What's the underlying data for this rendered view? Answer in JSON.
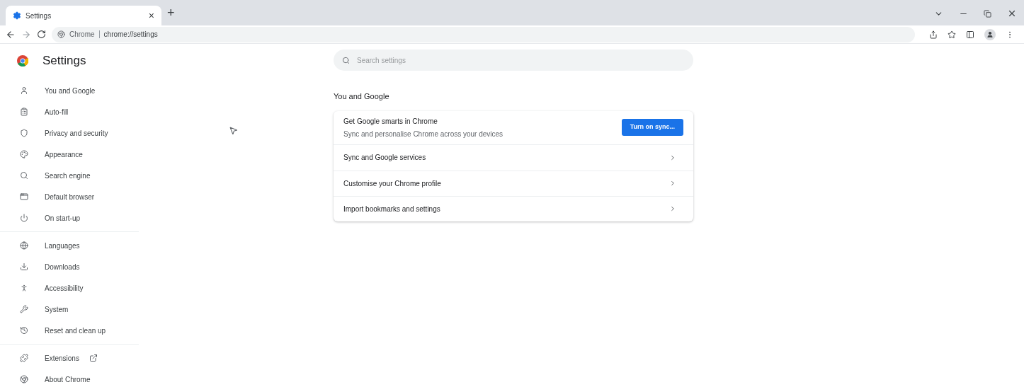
{
  "tabs": [
    {
      "title": "Settings",
      "close": "×",
      "selected": true
    }
  ],
  "new_tab": "+",
  "address_bar": {
    "site": "Chrome",
    "url": "chrome://settings"
  },
  "sidebar": {
    "title": "Settings",
    "groups": [
      {
        "items": [
          {
            "label": "You and Google",
            "external_link": false
          },
          {
            "label": "Auto-fill",
            "external_link": false
          },
          {
            "label": "Privacy and security",
            "external_link": false
          },
          {
            "label": "Appearance",
            "external_link": false
          },
          {
            "label": "Search engine",
            "external_link": false
          },
          {
            "label": "Default browser",
            "external_link": false
          },
          {
            "label": "On start-up",
            "external_link": false
          }
        ]
      },
      {
        "items": [
          {
            "label": "Languages",
            "external_link": false
          },
          {
            "label": "Downloads",
            "external_link": false
          },
          {
            "label": "Accessibility",
            "external_link": false
          },
          {
            "label": "System",
            "external_link": false
          },
          {
            "label": "Reset and clean up",
            "external_link": false
          }
        ]
      },
      {
        "items": [
          {
            "label": "Extensions",
            "external_link": true
          },
          {
            "label": "About Chrome",
            "external_link": false
          }
        ]
      }
    ]
  },
  "search": {
    "placeholder": "Search settings"
  },
  "section": {
    "title": "You and Google",
    "promo": {
      "title": "Get Google smarts in Chrome",
      "subtitle": "Sync and personalise Chrome across your devices",
      "button": "Turn on sync..."
    },
    "rows": [
      {
        "label": "Sync and Google services"
      },
      {
        "label": "Customise your Chrome profile"
      },
      {
        "label": "Import bookmarks and settings"
      }
    ]
  }
}
